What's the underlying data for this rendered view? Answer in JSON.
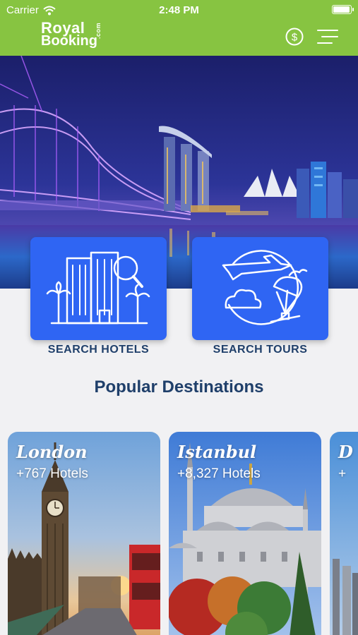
{
  "status_bar": {
    "carrier": "Carrier",
    "time": "2:48 PM",
    "battery_level": 1.0
  },
  "header": {
    "logo_line1": "Royal",
    "logo_line2": "Booking",
    "logo_suffix": ".com",
    "currency_icon": "dollar-circle-icon",
    "menu_icon": "hamburger-menu-icon",
    "brand_color": "#87c441"
  },
  "search": {
    "hotels_label": "SEARCH HOTELS",
    "tours_label": "SEARCH TOURS",
    "hotels_icon": "hotel-building-search-icon",
    "tours_icon": "plane-globe-parachute-icon",
    "button_color": "#2f65f3"
  },
  "section_title": "Popular Destinations",
  "destinations": [
    {
      "name": "London",
      "count": "+767 Hotels"
    },
    {
      "name": "Istanbul",
      "count": "+8,327  Hotels"
    },
    {
      "name": "D",
      "count": "+"
    }
  ]
}
